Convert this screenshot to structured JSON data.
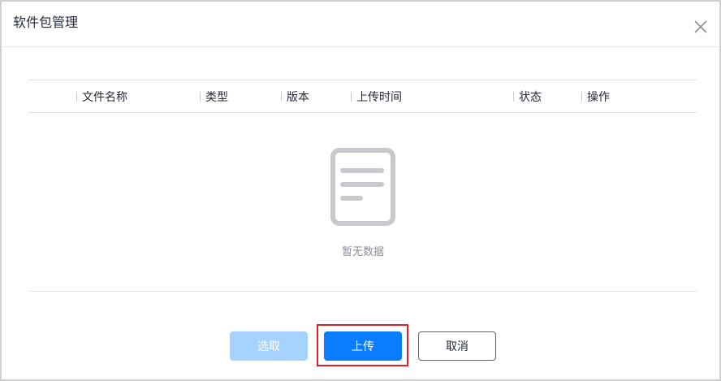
{
  "dialog": {
    "title": "软件包管理"
  },
  "table": {
    "columns": [
      "文件名称",
      "类型",
      "版本",
      "上传时间",
      "状态",
      "操作"
    ]
  },
  "empty_state": {
    "text": "暂无数据"
  },
  "buttons": {
    "select_label": "选取",
    "upload_label": "上传",
    "cancel_label": "取消"
  },
  "colors": {
    "primary": "#0a7cff",
    "primary_disabled": "#a6d2ff",
    "highlight": "#e02020"
  }
}
